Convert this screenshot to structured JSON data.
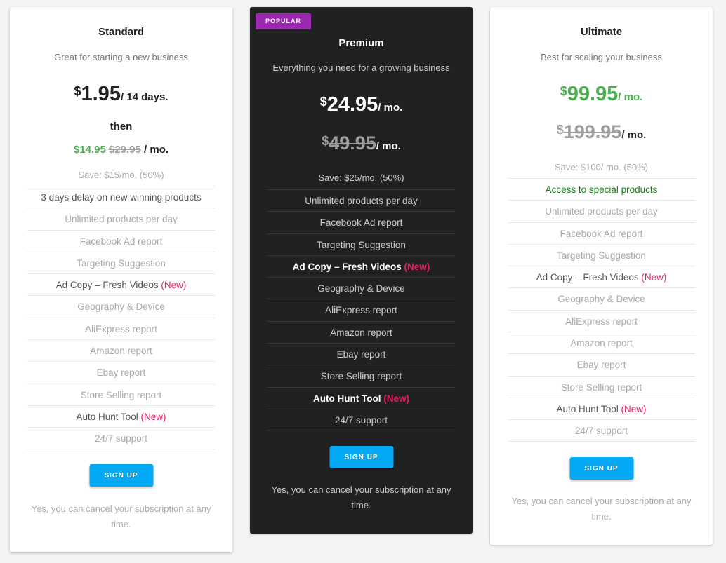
{
  "plans": [
    {
      "title": "Standard",
      "subtitle": "Great for starting a new business",
      "price": {
        "currency": "$",
        "amount": "1.95",
        "period": "/ 14 days."
      },
      "then_label": "then",
      "promo": {
        "new_price": "$14.95",
        "old_price": "$29.95",
        "period": "/ mo."
      },
      "save": "Save: $15/mo. (50%)",
      "features": [
        {
          "text": "3 days delay on new winning products",
          "style": "em",
          "badge": ""
        },
        {
          "text": "Unlimited products per day",
          "style": "muted",
          "badge": ""
        },
        {
          "text": "Facebook Ad report",
          "style": "muted",
          "badge": ""
        },
        {
          "text": "Targeting Suggestion",
          "style": "muted",
          "badge": ""
        },
        {
          "text": "Ad Copy – Fresh Videos",
          "style": "em",
          "badge": "(New)"
        },
        {
          "text": "Geography & Device",
          "style": "muted",
          "badge": ""
        },
        {
          "text": "AliExpress report",
          "style": "muted",
          "badge": ""
        },
        {
          "text": "Amazon report",
          "style": "muted",
          "badge": ""
        },
        {
          "text": "Ebay report",
          "style": "muted",
          "badge": ""
        },
        {
          "text": "Store Selling report",
          "style": "muted",
          "badge": ""
        },
        {
          "text": "Auto Hunt Tool",
          "style": "em",
          "badge": "(New)"
        },
        {
          "text": "24/7 support",
          "style": "muted",
          "badge": ""
        }
      ],
      "cta": "SIGN UP",
      "note": "Yes, you can cancel your subscription at any time."
    },
    {
      "badge": "POPULAR",
      "title": "Premium",
      "subtitle": "Everything you need for a growing business",
      "price": {
        "currency": "$",
        "amount": "24.95",
        "period": "/ mo."
      },
      "old_price": {
        "currency": "$",
        "amount": "49.95",
        "period": "/ mo."
      },
      "save": "Save: $25/mo. (50%)",
      "features": [
        {
          "text": "Unlimited products per day",
          "style": "muted",
          "badge": ""
        },
        {
          "text": "Facebook Ad report",
          "style": "muted",
          "badge": ""
        },
        {
          "text": "Targeting Suggestion",
          "style": "muted",
          "badge": ""
        },
        {
          "text": "Ad Copy – Fresh Videos",
          "style": "em",
          "badge": "(New)"
        },
        {
          "text": "Geography & Device",
          "style": "muted",
          "badge": ""
        },
        {
          "text": "AliExpress report",
          "style": "muted",
          "badge": ""
        },
        {
          "text": "Amazon report",
          "style": "muted",
          "badge": ""
        },
        {
          "text": "Ebay report",
          "style": "muted",
          "badge": ""
        },
        {
          "text": "Store Selling report",
          "style": "muted",
          "badge": ""
        },
        {
          "text": "Auto Hunt Tool",
          "style": "em",
          "badge": "(New)"
        },
        {
          "text": "24/7 support",
          "style": "muted",
          "badge": ""
        }
      ],
      "cta": "SIGN UP",
      "note": "Yes, you can cancel your subscription at any time."
    },
    {
      "title": "Ultimate",
      "subtitle": "Best for scaling your business",
      "price": {
        "currency": "$",
        "amount": "99.95",
        "period": "/ mo."
      },
      "old_price": {
        "currency": "$",
        "amount": "199.95",
        "period": "/ mo."
      },
      "save": "Save: $100/ mo. (50%)",
      "features": [
        {
          "text": "Access to special products",
          "style": "green",
          "badge": ""
        },
        {
          "text": "Unlimited products per day",
          "style": "muted",
          "badge": ""
        },
        {
          "text": "Facebook Ad report",
          "style": "muted",
          "badge": ""
        },
        {
          "text": "Targeting Suggestion",
          "style": "muted",
          "badge": ""
        },
        {
          "text": "Ad Copy – Fresh Videos",
          "style": "em",
          "badge": "(New)"
        },
        {
          "text": "Geography & Device",
          "style": "muted",
          "badge": ""
        },
        {
          "text": "AliExpress report",
          "style": "muted",
          "badge": ""
        },
        {
          "text": "Amazon report",
          "style": "muted",
          "badge": ""
        },
        {
          "text": "Ebay report",
          "style": "muted",
          "badge": ""
        },
        {
          "text": "Store Selling report",
          "style": "muted",
          "badge": ""
        },
        {
          "text": "Auto Hunt Tool",
          "style": "em",
          "badge": "(New)"
        },
        {
          "text": "24/7 support",
          "style": "muted",
          "badge": ""
        }
      ],
      "cta": "SIGN UP",
      "note": "Yes, you can cancel your subscription at any time."
    }
  ],
  "colors": {
    "accent_button": "#03a9f4",
    "popular_badge": "#9c27b0",
    "price_green": "#4caf50",
    "new_badge": "#e91e63",
    "premium_bg": "#212121"
  }
}
